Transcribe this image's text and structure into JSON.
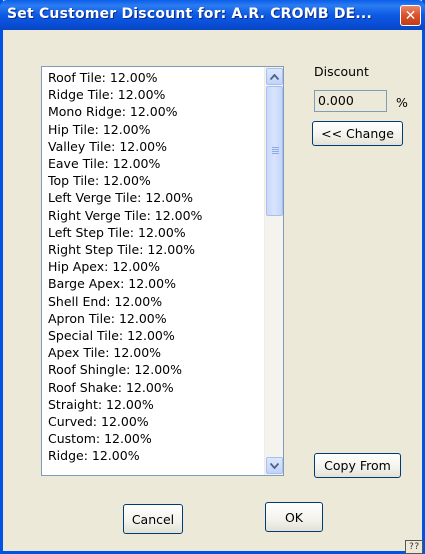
{
  "window": {
    "title": "Set Customer Discount for: A.R. CROMB DE...",
    "close_glyph": "✕"
  },
  "list": {
    "items": [
      "Roof Tile: 12.00%",
      "Ridge Tile: 12.00%",
      "Mono Ridge: 12.00%",
      "Hip Tile: 12.00%",
      "Valley Tile: 12.00%",
      "Eave Tile: 12.00%",
      "Top Tile: 12.00%",
      "Left Verge Tile: 12.00%",
      "Right Verge Tile: 12.00%",
      "Left Step Tile: 12.00%",
      "Right Step Tile: 12.00%",
      "Hip Apex: 12.00%",
      "Barge Apex: 12.00%",
      "Shell End: 12.00%",
      "Apron Tile: 12.00%",
      "Special Tile: 12.00%",
      "Apex Tile: 12.00%",
      "Roof Shingle: 12.00%",
      "Roof Shake: 12.00%",
      "Straight: 12.00%",
      "Curved: 12.00%",
      "Custom: 12.00%",
      "Ridge: 12.00%"
    ]
  },
  "discount": {
    "label": "Discount",
    "value": "0.000",
    "unit": "%"
  },
  "buttons": {
    "change": "<< Change",
    "copy_from": "Copy From",
    "cancel": "Cancel",
    "ok": "OK"
  },
  "icons": {
    "scroll_up": "scroll-up-arrow-icon",
    "scroll_down": "scroll-down-arrow-icon",
    "help": "help-icon"
  }
}
